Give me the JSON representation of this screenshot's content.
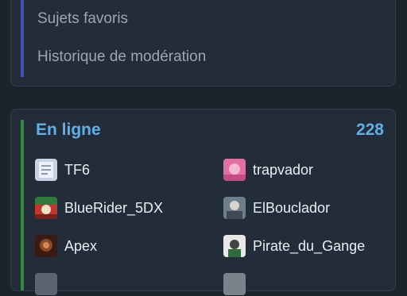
{
  "menu": {
    "items": [
      {
        "label": "Sujets favoris"
      },
      {
        "label": "Historique de modération"
      }
    ]
  },
  "online": {
    "title": "En ligne",
    "count": "228",
    "users": [
      {
        "name": "TF6",
        "avatar_color": "#c9d2e6"
      },
      {
        "name": "trapvador",
        "avatar_color": "#e46fa2"
      },
      {
        "name": "BlueRider_5DX",
        "avatar_color": "#c2382f"
      },
      {
        "name": "ElBouclador",
        "avatar_color": "#6f7f8a"
      },
      {
        "name": "Apex",
        "avatar_color": "#6b2a1a"
      },
      {
        "name": "Pirate_du_Gange",
        "avatar_color": "#e8e8e8"
      }
    ]
  },
  "colors": {
    "background": "#1b232d",
    "card": "#232d39",
    "accent_top": "#4451b8",
    "accent_online": "#2e8a3c",
    "title": "#5fb0ea"
  }
}
